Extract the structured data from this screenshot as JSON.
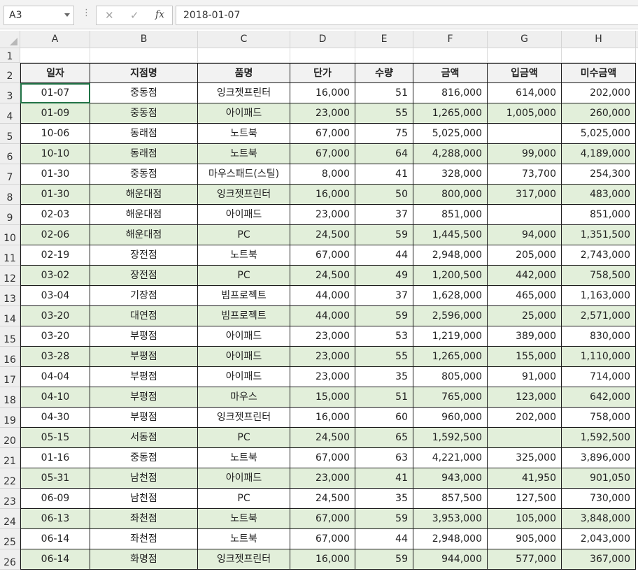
{
  "formula_bar": {
    "name_box": "A3",
    "content": "2018-01-07",
    "cancel_icon": "✕",
    "enter_icon": "✓",
    "fx_label": "fx"
  },
  "columns": [
    "A",
    "B",
    "C",
    "D",
    "E",
    "F",
    "G",
    "H"
  ],
  "row_numbers": [
    "1",
    "2",
    "3",
    "4",
    "5",
    "6",
    "7",
    "8",
    "9",
    "10",
    "11",
    "12",
    "13",
    "14",
    "15",
    "16",
    "17",
    "18",
    "19",
    "20",
    "21",
    "22",
    "23",
    "24",
    "25",
    "26"
  ],
  "table": {
    "headers": [
      "일자",
      "지점명",
      "품명",
      "단가",
      "수량",
      "금액",
      "입금액",
      "미수금액"
    ],
    "rows": [
      [
        "01-07",
        "중동점",
        "잉크젯프린터",
        "16,000",
        "51",
        "816,000",
        "614,000",
        "202,000"
      ],
      [
        "01-09",
        "중동점",
        "아이패드",
        "23,000",
        "55",
        "1,265,000",
        "1,005,000",
        "260,000"
      ],
      [
        "10-06",
        "동래점",
        "노트북",
        "67,000",
        "75",
        "5,025,000",
        "",
        "5,025,000"
      ],
      [
        "10-10",
        "동래점",
        "노트북",
        "67,000",
        "64",
        "4,288,000",
        "99,000",
        "4,189,000"
      ],
      [
        "01-30",
        "중동점",
        "마우스패드(스틸)",
        "8,000",
        "41",
        "328,000",
        "73,700",
        "254,300"
      ],
      [
        "01-30",
        "해운대점",
        "잉크젯프린터",
        "16,000",
        "50",
        "800,000",
        "317,000",
        "483,000"
      ],
      [
        "02-03",
        "해운대점",
        "아이패드",
        "23,000",
        "37",
        "851,000",
        "",
        "851,000"
      ],
      [
        "02-06",
        "해운대점",
        "PC",
        "24,500",
        "59",
        "1,445,500",
        "94,000",
        "1,351,500"
      ],
      [
        "02-19",
        "장전점",
        "노트북",
        "67,000",
        "44",
        "2,948,000",
        "205,000",
        "2,743,000"
      ],
      [
        "03-02",
        "장전점",
        "PC",
        "24,500",
        "49",
        "1,200,500",
        "442,000",
        "758,500"
      ],
      [
        "03-04",
        "기장점",
        "빔프로젝트",
        "44,000",
        "37",
        "1,628,000",
        "465,000",
        "1,163,000"
      ],
      [
        "03-20",
        "대연점",
        "빔프로젝트",
        "44,000",
        "59",
        "2,596,000",
        "25,000",
        "2,571,000"
      ],
      [
        "03-20",
        "부평점",
        "아이패드",
        "23,000",
        "53",
        "1,219,000",
        "389,000",
        "830,000"
      ],
      [
        "03-28",
        "부평점",
        "아이패드",
        "23,000",
        "55",
        "1,265,000",
        "155,000",
        "1,110,000"
      ],
      [
        "04-04",
        "부평점",
        "아이패드",
        "23,000",
        "35",
        "805,000",
        "91,000",
        "714,000"
      ],
      [
        "04-10",
        "부평점",
        "마우스",
        "15,000",
        "51",
        "765,000",
        "123,000",
        "642,000"
      ],
      [
        "04-30",
        "부평점",
        "잉크젯프린터",
        "16,000",
        "60",
        "960,000",
        "202,000",
        "758,000"
      ],
      [
        "05-15",
        "서동점",
        "PC",
        "24,500",
        "65",
        "1,592,500",
        "",
        "1,592,500"
      ],
      [
        "01-16",
        "중동점",
        "노트북",
        "67,000",
        "63",
        "4,221,000",
        "325,000",
        "3,896,000"
      ],
      [
        "05-31",
        "남천점",
        "아이패드",
        "23,000",
        "41",
        "943,000",
        "41,950",
        "901,050"
      ],
      [
        "06-09",
        "남천점",
        "PC",
        "24,500",
        "35",
        "857,500",
        "127,500",
        "730,000"
      ],
      [
        "06-13",
        "좌천점",
        "노트북",
        "67,000",
        "59",
        "3,953,000",
        "105,000",
        "3,848,000"
      ],
      [
        "06-14",
        "좌천점",
        "노트북",
        "67,000",
        "44",
        "2,948,000",
        "905,000",
        "2,043,000"
      ],
      [
        "06-14",
        "화명점",
        "잉크젯프린터",
        "16,000",
        "59",
        "944,000",
        "577,000",
        "367,000"
      ]
    ]
  },
  "colors": {
    "band": "#e2efda",
    "header_bg": "#efefef",
    "selection": "#217346"
  }
}
